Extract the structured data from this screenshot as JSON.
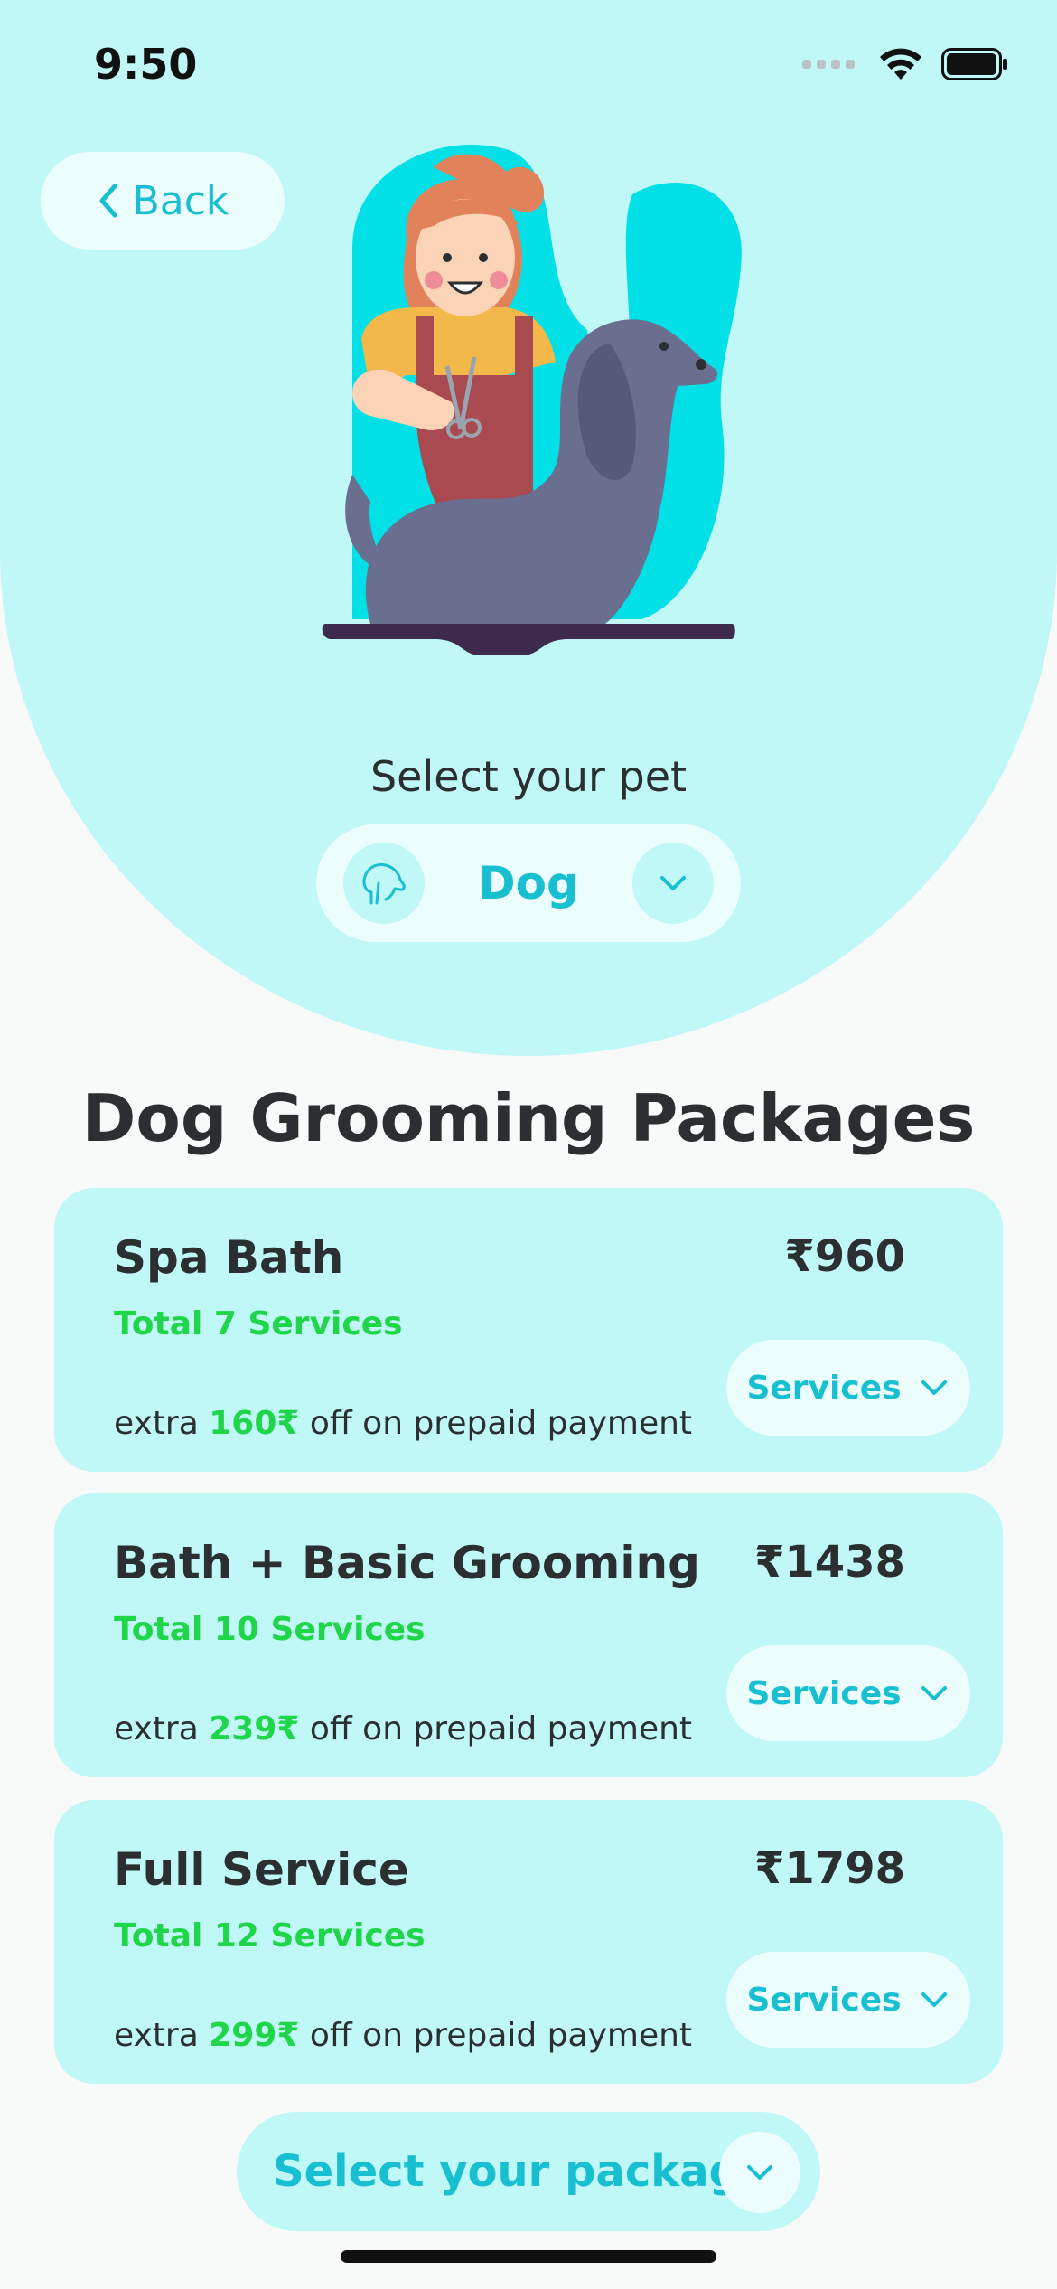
{
  "status_bar": {
    "time": "9:50"
  },
  "header": {
    "back_label": "Back"
  },
  "pet_selector": {
    "label": "Select your pet",
    "selected_pet": "Dog"
  },
  "section": {
    "title": "Dog Grooming Packages"
  },
  "packages": [
    {
      "name": "Spa Bath",
      "services_count": "Total 7 Services",
      "price": "₹960",
      "offer_prefix": "extra ",
      "offer_amount": "160₹",
      "offer_suffix": " off on prepaid payment",
      "services_label": "Services"
    },
    {
      "name": "Bath + Basic Grooming",
      "services_count": "Total 10 Services",
      "price": "₹1438",
      "offer_prefix": "extra ",
      "offer_amount": "239₹",
      "offer_suffix": " off on prepaid payment",
      "services_label": "Services"
    },
    {
      "name": "Full Service",
      "services_count": "Total 12 Services",
      "price": "₹1798",
      "offer_prefix": "extra ",
      "offer_amount": "299₹",
      "offer_suffix": " off on prepaid payment",
      "services_label": "Services"
    }
  ],
  "footer": {
    "select_package_label": "Select your package"
  },
  "colors": {
    "accent": "#17BFD0",
    "card_bg": "#C0F7F7",
    "pill_bg": "#ECFDFD",
    "offer_green": "#1FD64A",
    "text_dark": "#2B2F31"
  }
}
